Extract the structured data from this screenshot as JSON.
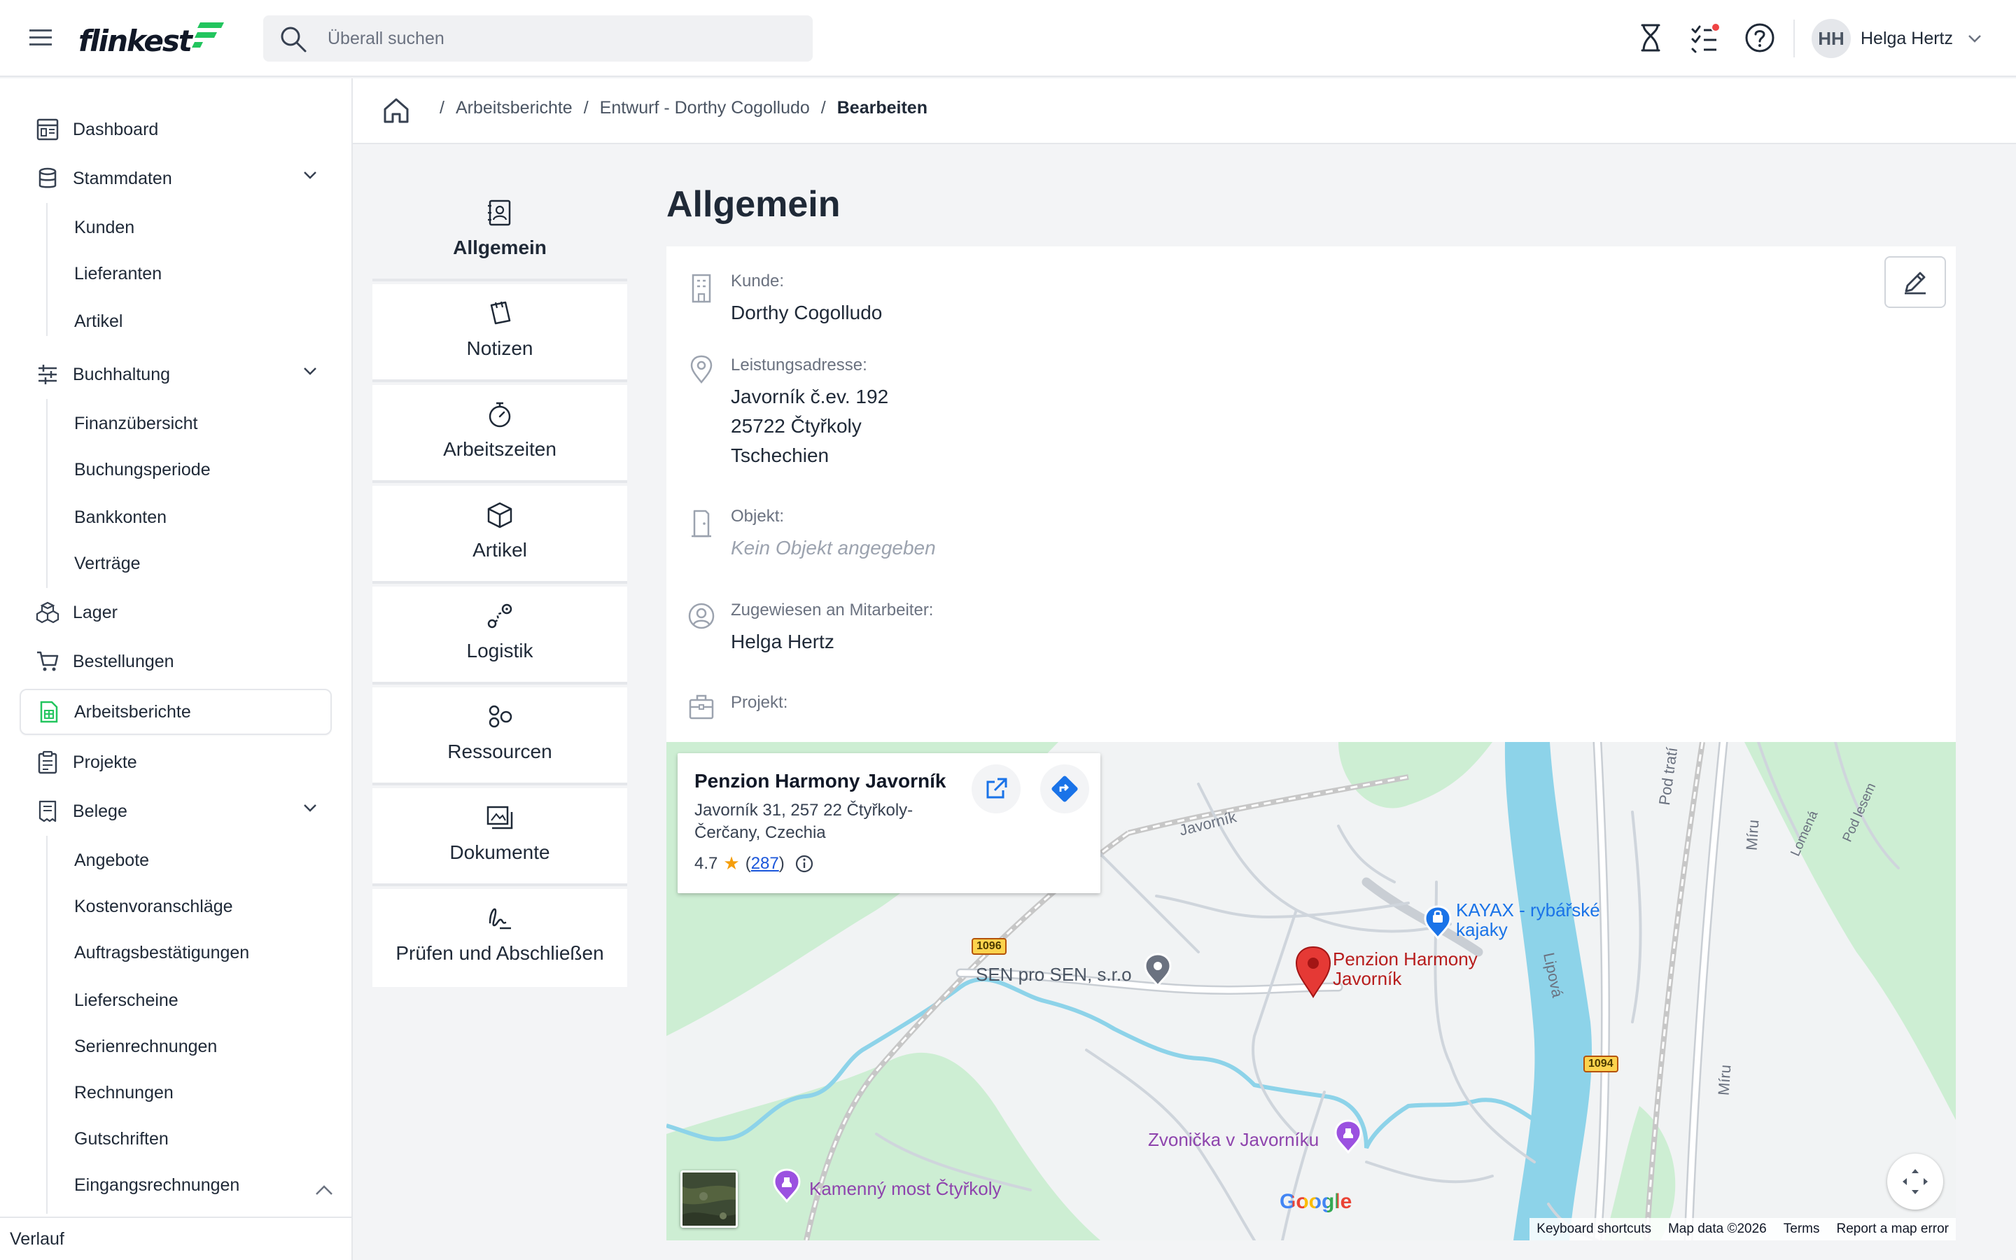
{
  "header": {
    "logo_text": "flinkest",
    "search_placeholder": "Überall suchen",
    "user_initials": "HH",
    "user_name": "Helga Hertz"
  },
  "sidebar": {
    "items": [
      {
        "label": "Dashboard",
        "icon": "dashboard-icon"
      },
      {
        "label": "Stammdaten",
        "icon": "database-icon",
        "children": [
          "Kunden",
          "Lieferanten",
          "Artikel"
        ]
      },
      {
        "label": "Buchhaltung",
        "icon": "sliders-icon",
        "children": [
          "Finanzübersicht",
          "Buchungsperiode",
          "Bankkonten",
          "Verträge"
        ]
      },
      {
        "label": "Lager",
        "icon": "boxes-icon"
      },
      {
        "label": "Bestellungen",
        "icon": "cart-icon"
      },
      {
        "label": "Arbeitsberichte",
        "icon": "report-icon",
        "active": true
      },
      {
        "label": "Projekte",
        "icon": "clipboard-icon"
      },
      {
        "label": "Belege",
        "icon": "receipt-icon",
        "children": [
          "Angebote",
          "Kostenvoranschläge",
          "Auftragsbestätigungen",
          "Lieferscheine",
          "Serienrechnungen",
          "Rechnungen",
          "Gutschriften",
          "Eingangsrechnungen"
        ]
      }
    ],
    "footer_label": "Verlauf"
  },
  "breadcrumb": {
    "items": [
      "Arbeitsberichte",
      "Entwurf - Dorthy Cogolludo",
      "Bearbeiten"
    ]
  },
  "tabs": [
    {
      "label": "Allgemein",
      "icon": "contact-book-icon",
      "active": true
    },
    {
      "label": "Notizen",
      "icon": "notes-icon"
    },
    {
      "label": "Arbeitszeiten",
      "icon": "stopwatch-icon"
    },
    {
      "label": "Artikel",
      "icon": "cube-icon"
    },
    {
      "label": "Logistik",
      "icon": "route-icon"
    },
    {
      "label": "Ressourcen",
      "icon": "resources-icon"
    },
    {
      "label": "Dokumente",
      "icon": "documents-icon"
    },
    {
      "label": "Prüfen und Abschließen",
      "icon": "signature-icon"
    }
  ],
  "section": {
    "title": "Allgemein",
    "fields": [
      {
        "label": "Kunde:",
        "value": "Dorthy Cogolludo",
        "icon": "building-icon"
      },
      {
        "label": "Leistungsadresse:",
        "lines": [
          "Javorník č.ev. 192",
          "25722 Čtyřkoly",
          "Tschechien"
        ],
        "icon": "map-pin-icon"
      },
      {
        "label": "Objekt:",
        "value": "Kein Objekt angegeben",
        "empty": true,
        "icon": "door-icon"
      },
      {
        "label": "Zugewiesen an Mitarbeiter:",
        "value": "Helga Hertz",
        "icon": "user-circle-icon"
      },
      {
        "label": "Projekt:",
        "value": "",
        "icon": "briefcase-icon"
      }
    ]
  },
  "map": {
    "info": {
      "title": "Penzion Harmony Javorník",
      "address": "Javorník 31, 257 22 Čtyřkoly-Čerčany, Czechia",
      "rating": "4.7",
      "reviews": "287"
    },
    "places": {
      "marker": "Penzion Harmony Javorník",
      "kayak": "KAYAX - rybářské kajaky",
      "sen": "SEN pro SEN, s.r.o",
      "zvonicka": "Zvonička v Javorníku",
      "most": "Kamenný most Čtyřkoly"
    },
    "streets": {
      "javornik": "Javorník",
      "lipova": "Lipová",
      "miru1": "Míru",
      "miru2": "Míru",
      "pod_trati": "Pod tratí",
      "lomena": "Lomená",
      "pod_lesem": "Pod lesem"
    },
    "road_numbers": {
      "r1096": "1096",
      "r1094": "1094"
    },
    "google_logo": "Google",
    "footer": [
      "Keyboard shortcuts",
      "Map data ©2026",
      "Terms",
      "Report a map error"
    ],
    "colors": {
      "park": "#cdeed3",
      "river": "#8dd3e9",
      "road": "#ffffff",
      "marker": "#e53935",
      "poi_purple": "#8e44ad",
      "poi_blue": "#1a73e8"
    }
  }
}
